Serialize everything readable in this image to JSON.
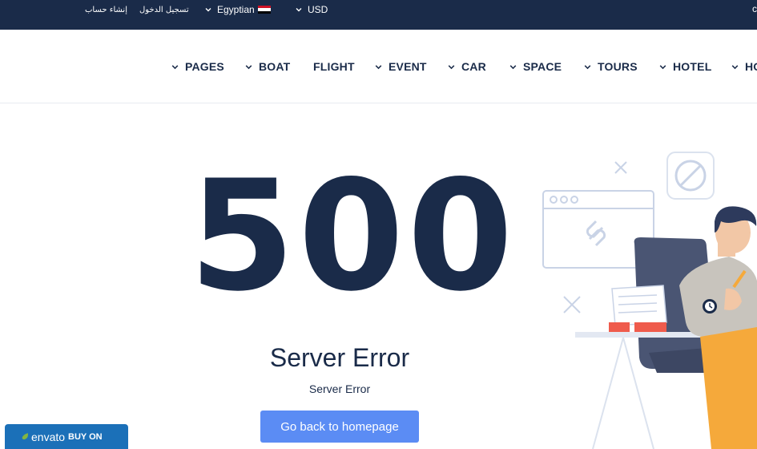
{
  "topbar": {
    "register": "إنشاء حساب",
    "login": "تسجيل الدخول",
    "language": "Egyptian",
    "currency": "USD",
    "edge": "c"
  },
  "nav": {
    "items": [
      {
        "label": "PAGES",
        "has_dropdown": true
      },
      {
        "label": "BOAT",
        "has_dropdown": true
      },
      {
        "label": "FLIGHT",
        "has_dropdown": false
      },
      {
        "label": "EVENT",
        "has_dropdown": true
      },
      {
        "label": "CAR",
        "has_dropdown": true
      },
      {
        "label": "SPACE",
        "has_dropdown": true
      },
      {
        "label": "TOURS",
        "has_dropdown": true
      },
      {
        "label": "HOTEL",
        "has_dropdown": true
      },
      {
        "label": "HO",
        "has_dropdown": true
      }
    ]
  },
  "error": {
    "code": "500",
    "title": "Server Error",
    "message": "Server Error",
    "button_label": "Go back to homepage"
  },
  "badge": {
    "brand": "envato",
    "action": "BUY ON"
  },
  "colors": {
    "navy": "#1a2b49",
    "accent_blue": "#5b8cf4",
    "envato_blue": "#1b70b8",
    "envato_green": "#82b541"
  }
}
